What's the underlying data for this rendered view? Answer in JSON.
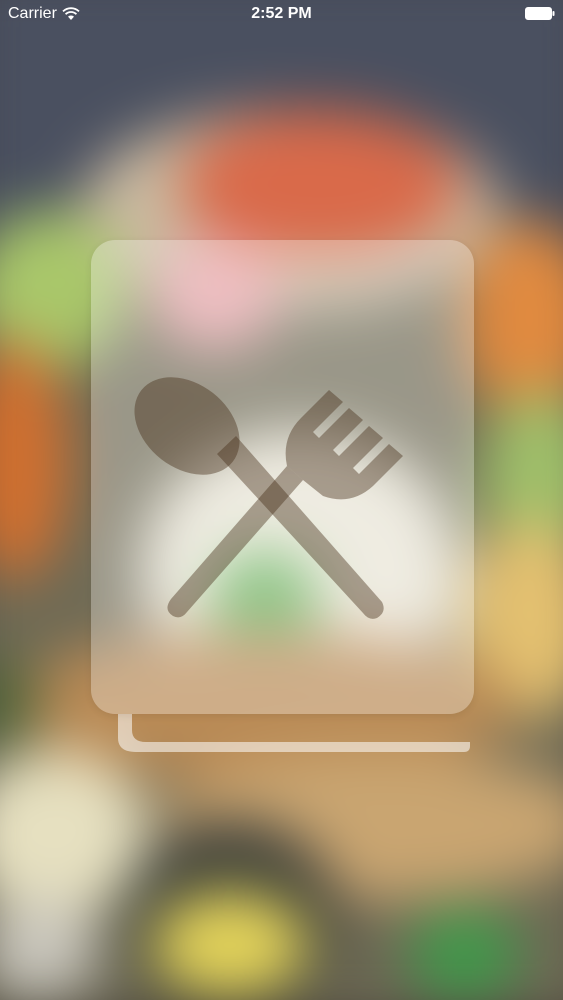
{
  "status_bar": {
    "carrier": "Carrier",
    "time": "2:52 PM"
  },
  "splash": {
    "icon": "cookbook-fork-spoon-icon"
  },
  "colors": {
    "card_tint": "#ffffff",
    "utensil_tint": "#5a3a1e",
    "status_text": "#ffffff"
  }
}
